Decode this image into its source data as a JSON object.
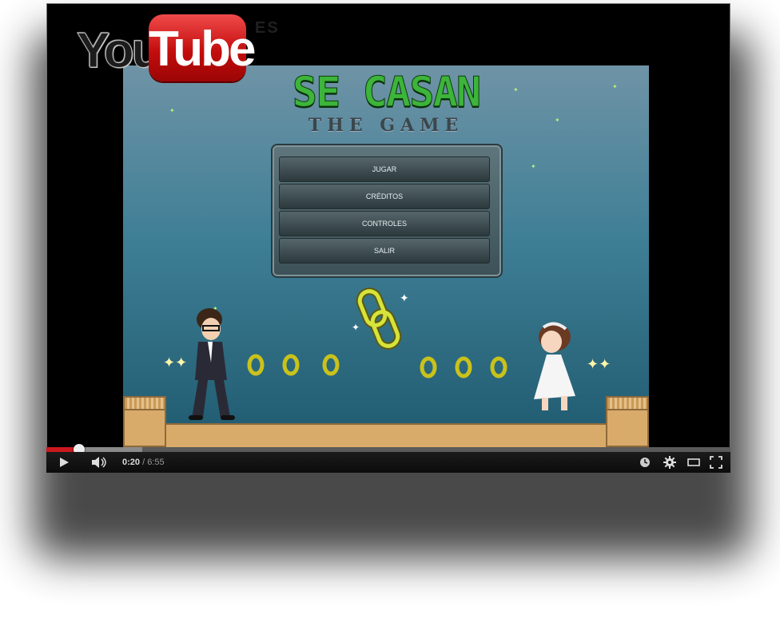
{
  "header": {
    "logo_you": "You",
    "logo_tube": "Tube",
    "locale": "ES"
  },
  "game": {
    "title": "SE CASAN",
    "subtitle": "THE GAME",
    "menu": [
      "JUGAR",
      "CRÉDITOS",
      "CONTROLES",
      "SALIR"
    ]
  },
  "player": {
    "current_time": "0:20",
    "separator": "/",
    "duration": "6:55",
    "played_fraction": 0.048,
    "buffered_fraction": 0.14
  },
  "icons": {
    "play": "play-icon",
    "volume": "volume-icon",
    "watch_later": "clock-icon",
    "settings": "gear-icon",
    "theater": "theater-mode-icon",
    "fullscreen": "fullscreen-icon"
  },
  "colors": {
    "progress_played": "#cc181e",
    "logo_red": "#c40d0d",
    "title_green": "#3db43a"
  }
}
